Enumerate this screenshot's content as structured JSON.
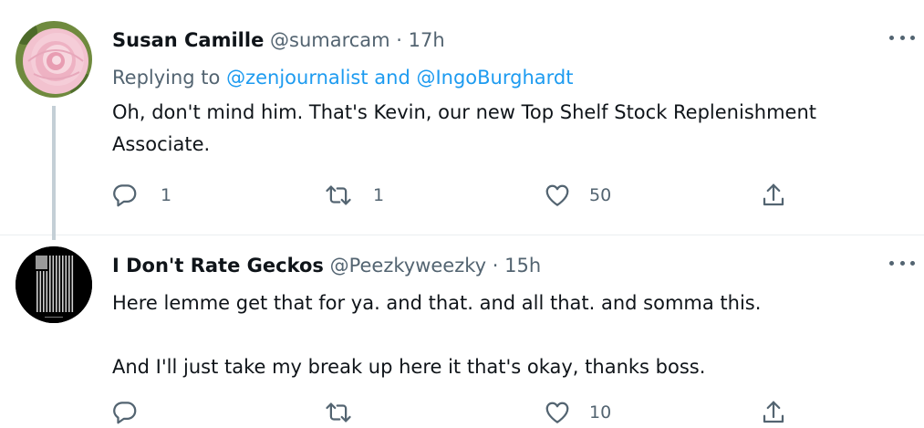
{
  "tweets": [
    {
      "name": "Susan Camille",
      "handle": "@sumarcam",
      "dot": " · ",
      "time": "17h",
      "replying_prefix": "Replying to ",
      "replying_mention_1": "@zenjournalist",
      "replying_and": " and ",
      "replying_mention_2": "@IngoBurghardt",
      "body": [
        "Oh, don't mind him. That's Kevin, our new Top Shelf Stock Replenishment Associate."
      ],
      "reply_count": "1",
      "retweet_count": "1",
      "like_count": "50",
      "avatar_icon": "camellia-flower-photo"
    },
    {
      "name": "I Don't Rate Geckos",
      "handle": "@Peezkyweezky",
      "dot": " · ",
      "time": "15h",
      "body": [
        "Here lemme get that for ya. and that. and all that. and somma this.",
        "And I'll just take my break up here it that's okay, thanks boss."
      ],
      "reply_count": "",
      "retweet_count": "",
      "like_count": "10",
      "avatar_icon": "black-white-flag-avatar"
    }
  ],
  "colors": {
    "text": "#0f1419",
    "secondary": "#536471",
    "link": "#1d9bf0",
    "thread_line": "#c4cfd6"
  }
}
